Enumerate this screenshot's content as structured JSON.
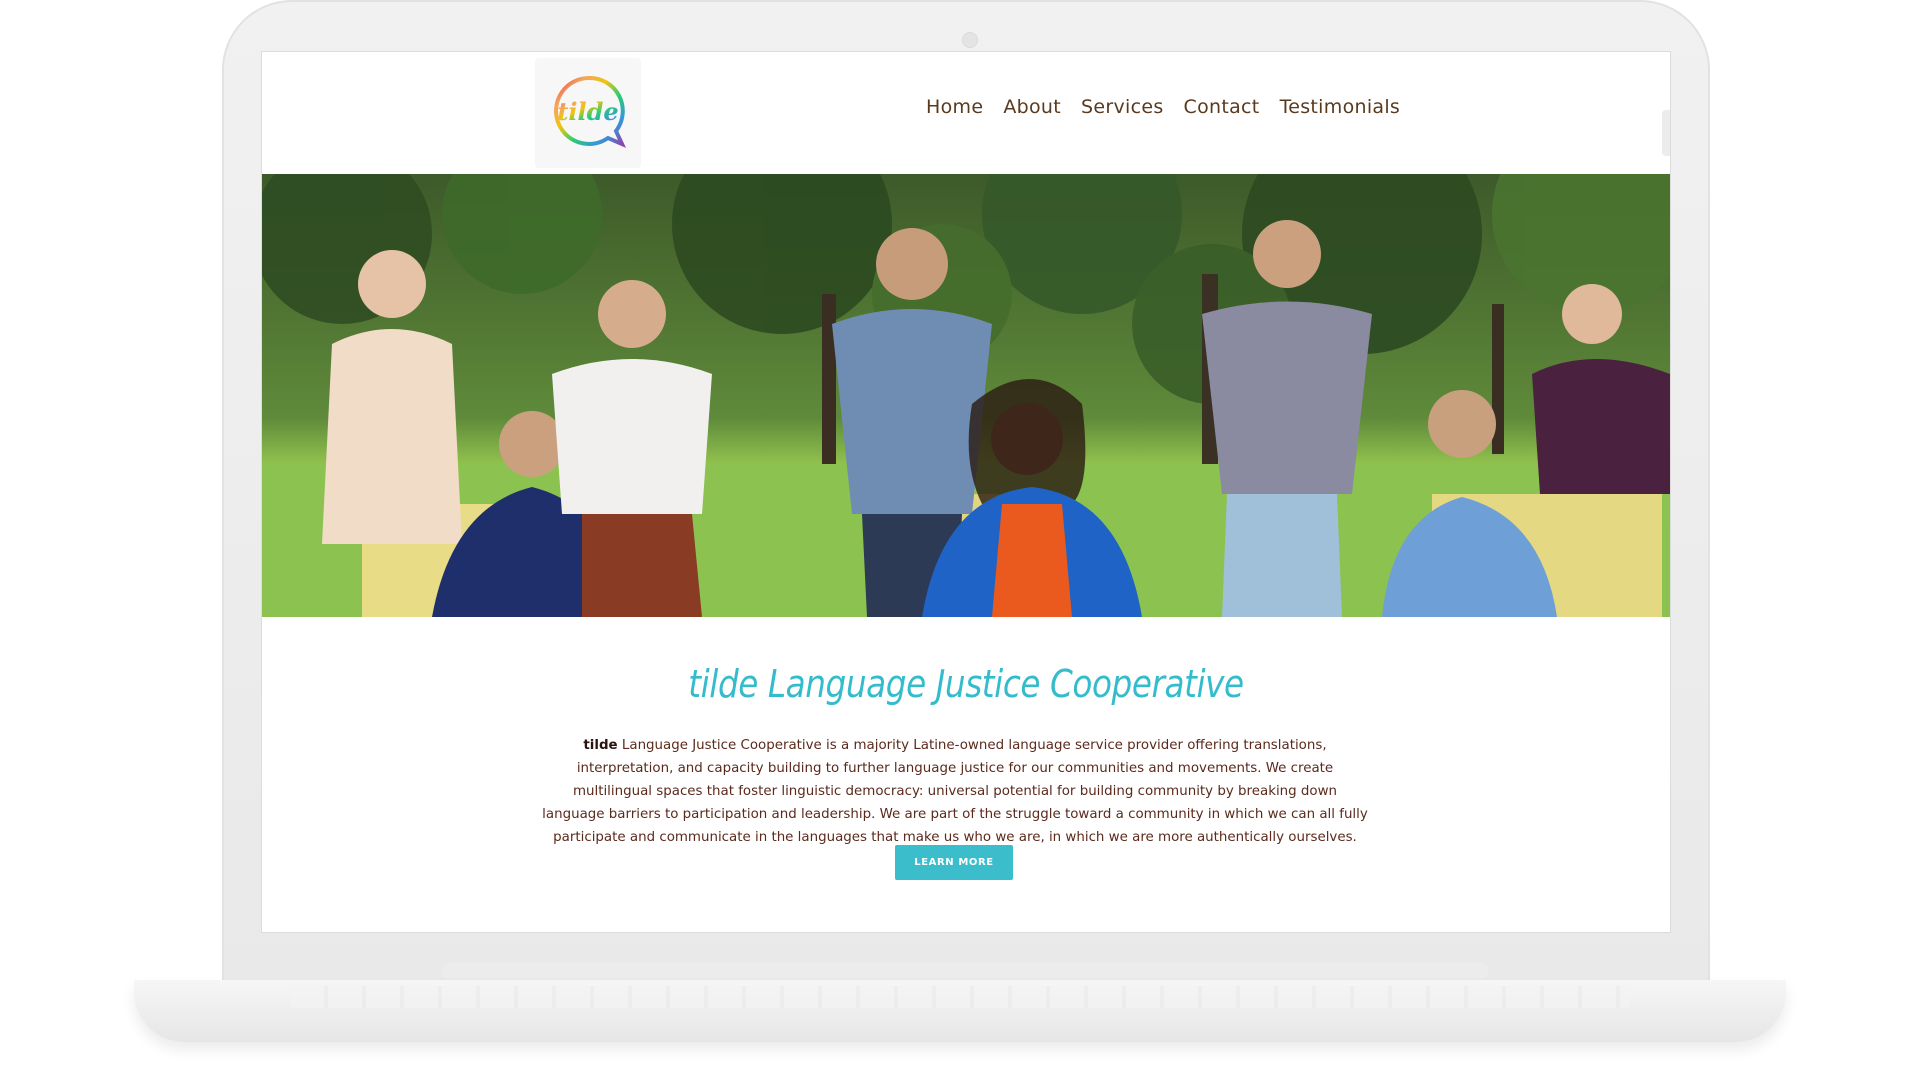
{
  "site": {
    "logo_text": "tilde",
    "nav": [
      "Home",
      "About",
      "Services",
      "Contact",
      "Testimonials"
    ]
  },
  "intro": {
    "title": "tilde Language Justice Cooperative",
    "brand": "tilde",
    "body": " Language Justice Cooperative is a majority Latine-owned language service provider offering translations, interpretation, and capacity building to further language justice for our communities and movements. We create multilingual spaces that foster linguistic democracy: universal potential for building community by breaking down language barriers to participation and leadership. We are part of the struggle toward a community in which we can all fully participate and communicate in the languages that make us who we are, in which we are more authentically ourselves.",
    "button": "LEARN MORE"
  },
  "colors": {
    "accent": "#3bbdcc",
    "nav_text": "#5a3a1e",
    "body_text": "#5b2a1c"
  },
  "hero_image": "group-photo-outdoors"
}
